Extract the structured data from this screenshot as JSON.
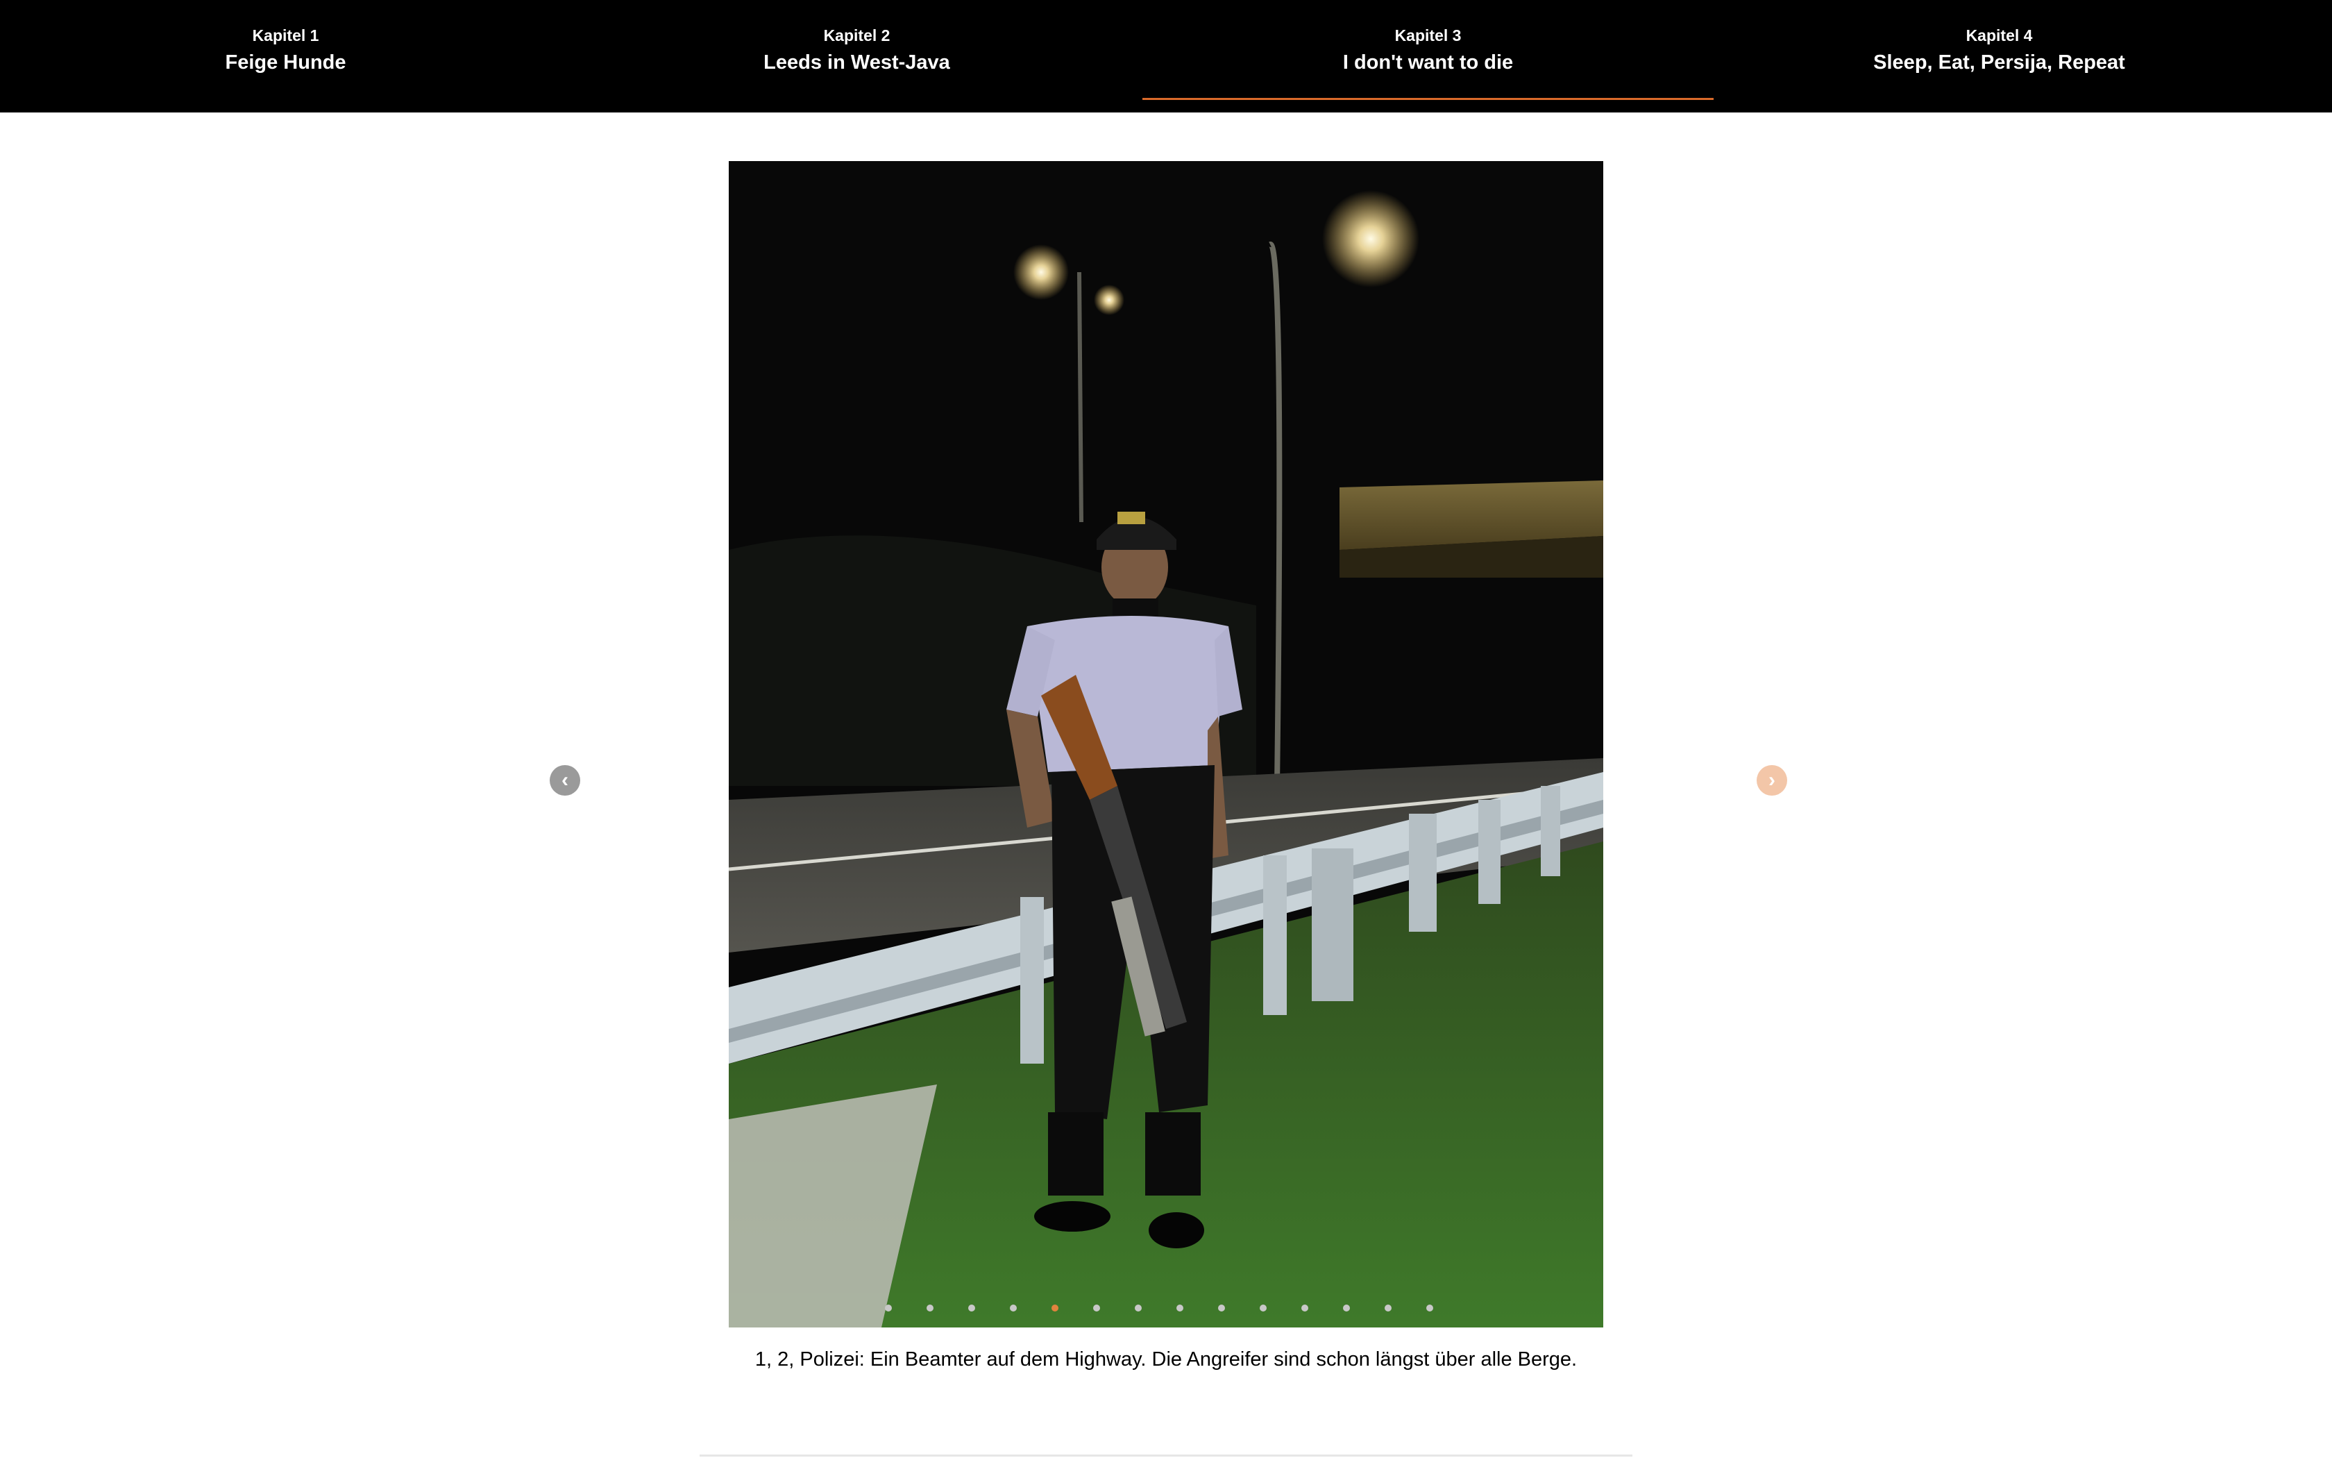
{
  "chapters": [
    {
      "kapitel": "Kapitel 1",
      "title": "Feige Hunde",
      "active": false
    },
    {
      "kapitel": "Kapitel 2",
      "title": "Leeds in West-Java",
      "active": false
    },
    {
      "kapitel": "Kapitel 3",
      "title": "I don't want to die",
      "active": true
    },
    {
      "kapitel": "Kapitel 4",
      "title": "Sleep, Eat, Persija, Repeat",
      "active": false
    }
  ],
  "slider": {
    "caption": "1, 2, Polizei: Ein Beamter auf dem Highway. Die Angreifer sind schon längst über alle Berge.",
    "prev_icon": "chevron-left-icon",
    "next_icon": "chevron-right-icon",
    "prev_glyph": "‹",
    "next_glyph": "›",
    "total_slides": 14,
    "current_slide": 5
  },
  "colors": {
    "accent": "#d96a2a",
    "nav_background": "#000000"
  }
}
